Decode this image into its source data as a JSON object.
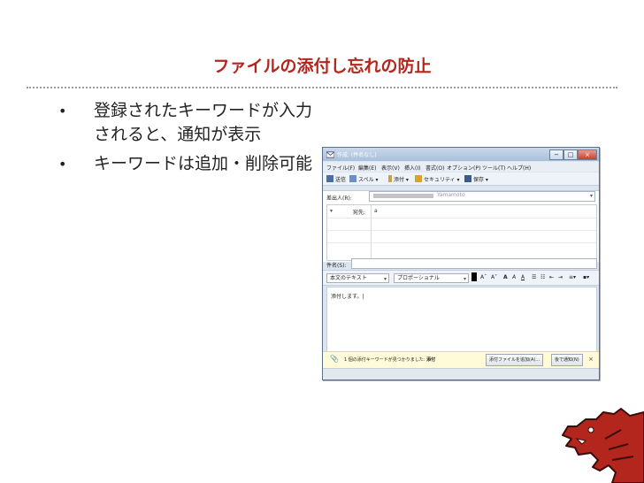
{
  "slide": {
    "title": "ファイルの添付し忘れの防止",
    "bullets": [
      {
        "text": "登録されたキーワードが入力されると、通知が表示"
      },
      {
        "text": "キーワードは追加・削除可能"
      }
    ],
    "bullet_symbol": "•"
  },
  "window": {
    "title": "作成: (件名なし)",
    "menu": [
      "ファイル(F)",
      "編集(E)",
      "表示(V)",
      "挿入(I)",
      "書式(O)",
      "オプション(P)",
      "ツール(T)",
      "ヘルプ(H)"
    ],
    "toolbar": {
      "send": "送信",
      "spell": "スペル",
      "attach": "添付",
      "security": "セキュリティ",
      "save": "保存"
    },
    "from_label": "差出人(R):",
    "from_value": "Yamamoto",
    "to_label": "宛先:",
    "to_value": "a",
    "subject_label": "件名(S):",
    "subject_value": "",
    "format": {
      "paragraph": "本文のテキスト",
      "font": "プロポーショナル"
    },
    "body_text": "添付します。|",
    "notification": {
      "text": "1 個の添付キーワードが見つかりました:",
      "keyword": "添付",
      "add_button": "添付ファイルを追加(A)...",
      "later_button": "後で通知(N)",
      "close": "×"
    },
    "controls": {
      "minimize": "−",
      "maximize": "□",
      "close": "×"
    }
  },
  "colors": {
    "title": "#b3261e",
    "mascot": "#b3261e"
  }
}
